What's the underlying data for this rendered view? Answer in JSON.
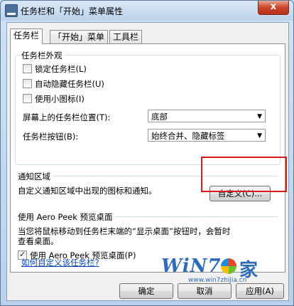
{
  "window": {
    "title": "任务栏和「开始」菜单属性",
    "close_label": "x"
  },
  "tabs": [
    {
      "label": "任务栏"
    },
    {
      "label": "「开始」菜单"
    },
    {
      "label": "工具栏"
    }
  ],
  "appearance": {
    "group_title": "任务栏外观",
    "checkboxes": [
      {
        "label": "锁定任务栏(L)",
        "checked": false
      },
      {
        "label": "自动隐藏任务栏(U)",
        "checked": false
      },
      {
        "label": "使用小图标(I)",
        "checked": false
      }
    ],
    "location_label": "屏幕上的任务栏位置(T):",
    "location_value": "底部",
    "buttons_label": "任务栏按钮(B):",
    "buttons_value": "始终合并、隐藏标签"
  },
  "notification": {
    "group_title": "通知区域",
    "description": "自定义通知区域中出现的图标和通知。",
    "customize_label": "自定义(C)..."
  },
  "aero_peek": {
    "group_title": "使用 Aero Peek 预览桌面",
    "description_line1": "当您将鼠标移动到任务栏末端的“显示桌面”按钮时，会暂时",
    "description_line2": "查看桌面。",
    "checkbox_label": "使用 Aero Peek 预览桌面(P)",
    "checked": true
  },
  "help_link": "如何自定义该任务栏?",
  "footer": {
    "ok_label": "确定",
    "cancel_label": "取消",
    "apply_label": "应用(A)"
  },
  "watermark": {
    "brand": "WiN7.",
    "jia": "家",
    "url": "www.win7zhijia.cn"
  }
}
